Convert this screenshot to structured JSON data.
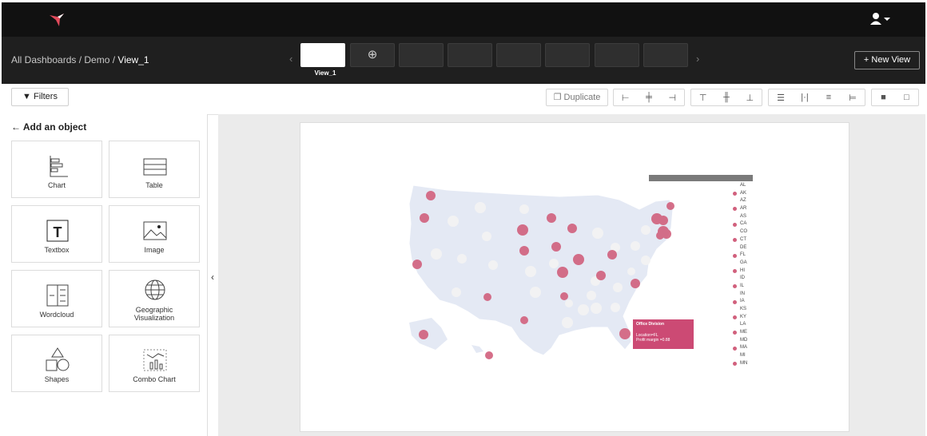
{
  "header": {
    "logo_icon": "hummingbird-logo",
    "user_icon": "user-dropdown-icon"
  },
  "breadcrumb": {
    "root": "All Dashboards",
    "sep1": " / ",
    "mid": "Demo",
    "sep2": " / ",
    "current": "View_1"
  },
  "tabs": {
    "active_label": "View_1",
    "add_icon": "plus-circle-icon",
    "prev_icon": "chevron-left-icon",
    "next_icon": "chevron-right-icon"
  },
  "actions": {
    "new_view": "+ New View",
    "filters": "Filters",
    "duplicate": "Duplicate"
  },
  "panel": {
    "title": "Add an object",
    "objects": [
      {
        "label": "Chart",
        "icon": "chart-icon"
      },
      {
        "label": "Table",
        "icon": "table-icon"
      },
      {
        "label": "Textbox",
        "icon": "textbox-icon"
      },
      {
        "label": "Image",
        "icon": "image-icon"
      },
      {
        "label": "Wordcloud",
        "icon": "wordcloud-icon"
      },
      {
        "label": "Geographic\nVisualization",
        "icon": "globe-icon"
      },
      {
        "label": "Shapes",
        "icon": "shapes-icon"
      },
      {
        "label": "Combo Chart",
        "icon": "combo-chart-icon"
      }
    ]
  },
  "map": {
    "legend": [
      "AL",
      "AK",
      "AZ",
      "AR",
      "AS",
      "CA",
      "CO",
      "CT",
      "DE",
      "FL",
      "GA",
      "HI",
      "ID",
      "IL",
      "IN",
      "IA",
      "KS",
      "KY",
      "LA",
      "ME",
      "MD",
      "MA",
      "MI",
      "MN"
    ],
    "legend_on": [
      false,
      true,
      false,
      true,
      false,
      true,
      false,
      true,
      false,
      true,
      false,
      true,
      false,
      true,
      false,
      true,
      false,
      true,
      false,
      true,
      false,
      true,
      false,
      true
    ],
    "tooltip": {
      "title": "Office Division",
      "line1": "Location=FL",
      "line2": "Profit margin =0.88"
    },
    "marker_color": "#d1607d"
  }
}
